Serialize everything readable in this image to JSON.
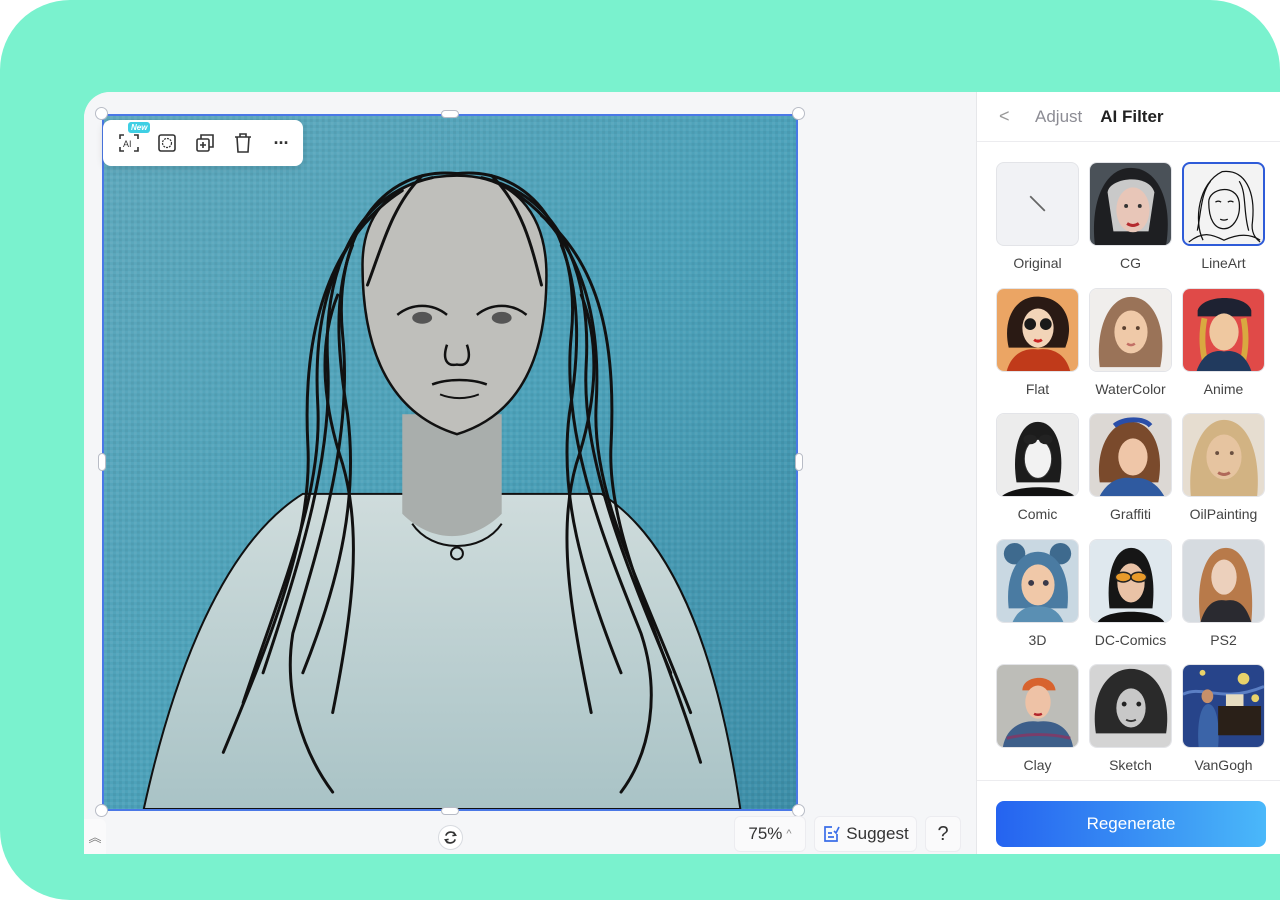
{
  "toolbar": {
    "ai_button_icon": "ai-scan-icon",
    "new_badge": "New",
    "items": [
      {
        "name": "ai-scan-icon",
        "label": "AI"
      },
      {
        "name": "cutout-icon"
      },
      {
        "name": "duplicate-icon"
      },
      {
        "name": "delete-icon"
      },
      {
        "name": "more-icon",
        "glyph": "···"
      }
    ]
  },
  "canvas": {
    "zoom_label": "75%",
    "zoom_caret": "^",
    "suggest_label": "Suggest",
    "help_label": "?",
    "collapse_glyph": "︽"
  },
  "panel": {
    "back_glyph": "<",
    "tabs": [
      {
        "label": "Adjust",
        "active": false
      },
      {
        "label": "AI Filter",
        "active": true
      }
    ],
    "filters": [
      {
        "label": "Original",
        "selected": false
      },
      {
        "label": "CG",
        "selected": false
      },
      {
        "label": "LineArt",
        "selected": true
      },
      {
        "label": "Flat",
        "selected": false
      },
      {
        "label": "WaterColor",
        "selected": false
      },
      {
        "label": "Anime",
        "selected": false
      },
      {
        "label": "Comic",
        "selected": false
      },
      {
        "label": "Graffiti",
        "selected": false
      },
      {
        "label": "OilPainting",
        "selected": false
      },
      {
        "label": "3D",
        "selected": false
      },
      {
        "label": "DC-Comics",
        "selected": false
      },
      {
        "label": "PS2",
        "selected": false
      },
      {
        "label": "Clay",
        "selected": false
      },
      {
        "label": "Sketch",
        "selected": false
      },
      {
        "label": "VanGogh",
        "selected": false
      }
    ],
    "regenerate_label": "Regenerate"
  },
  "colors": {
    "accent": "#2e5bd8",
    "background_teal": "#7af2ce",
    "selection_border": "#4a78e6"
  }
}
